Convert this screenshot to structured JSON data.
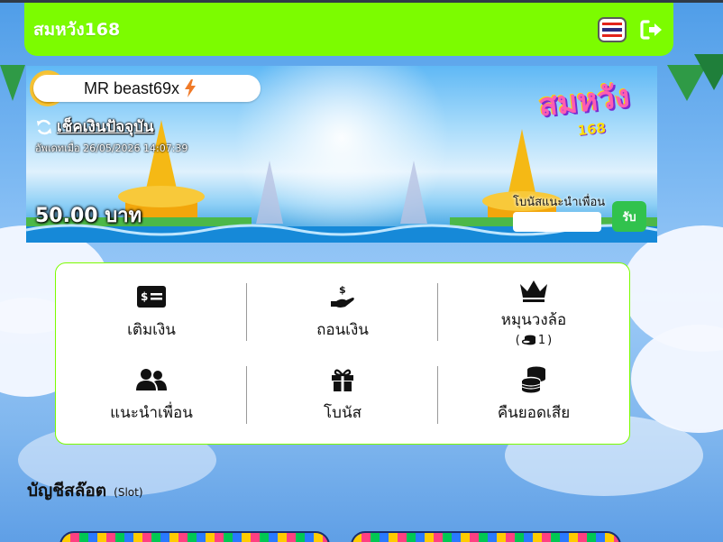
{
  "header": {
    "brand": "สมหวัง168",
    "language_flag": "thai-flag-icon",
    "logout_icon": "logout-icon"
  },
  "banner": {
    "username": "MR beast69x",
    "check_balance_label": "เช็คเงินปัจจุบัน",
    "updated_label": "อัพเดทเมื่อ 26/05/2026 14:07:39",
    "balance": "50.00 บาท",
    "logo_text": "สมหวัง",
    "logo_sub": "168",
    "referral_label": "โบนัสแนะนำเพื่อน",
    "referral_input_value": "",
    "referral_button": "รับ"
  },
  "menu": {
    "items": [
      {
        "label": "เติมเงิน",
        "icon": "deposit-bill-icon"
      },
      {
        "label": "ถอนเงิน",
        "icon": "withdraw-hand-icon"
      },
      {
        "label": "หมุนวงล้อ",
        "icon": "crown-icon",
        "sub": "1"
      },
      {
        "label": "แนะนำเพื่อน",
        "icon": "users-icon"
      },
      {
        "label": "โบนัส",
        "icon": "gift-icon"
      },
      {
        "label": "คืนยอดเสีย",
        "icon": "coins-stack-icon"
      }
    ]
  },
  "slot_section": {
    "title": "บัญชีสล๊อต",
    "subtitle": "(Slot)"
  },
  "colors": {
    "accent_green": "#7cfc00",
    "button_green": "#31c24d"
  }
}
